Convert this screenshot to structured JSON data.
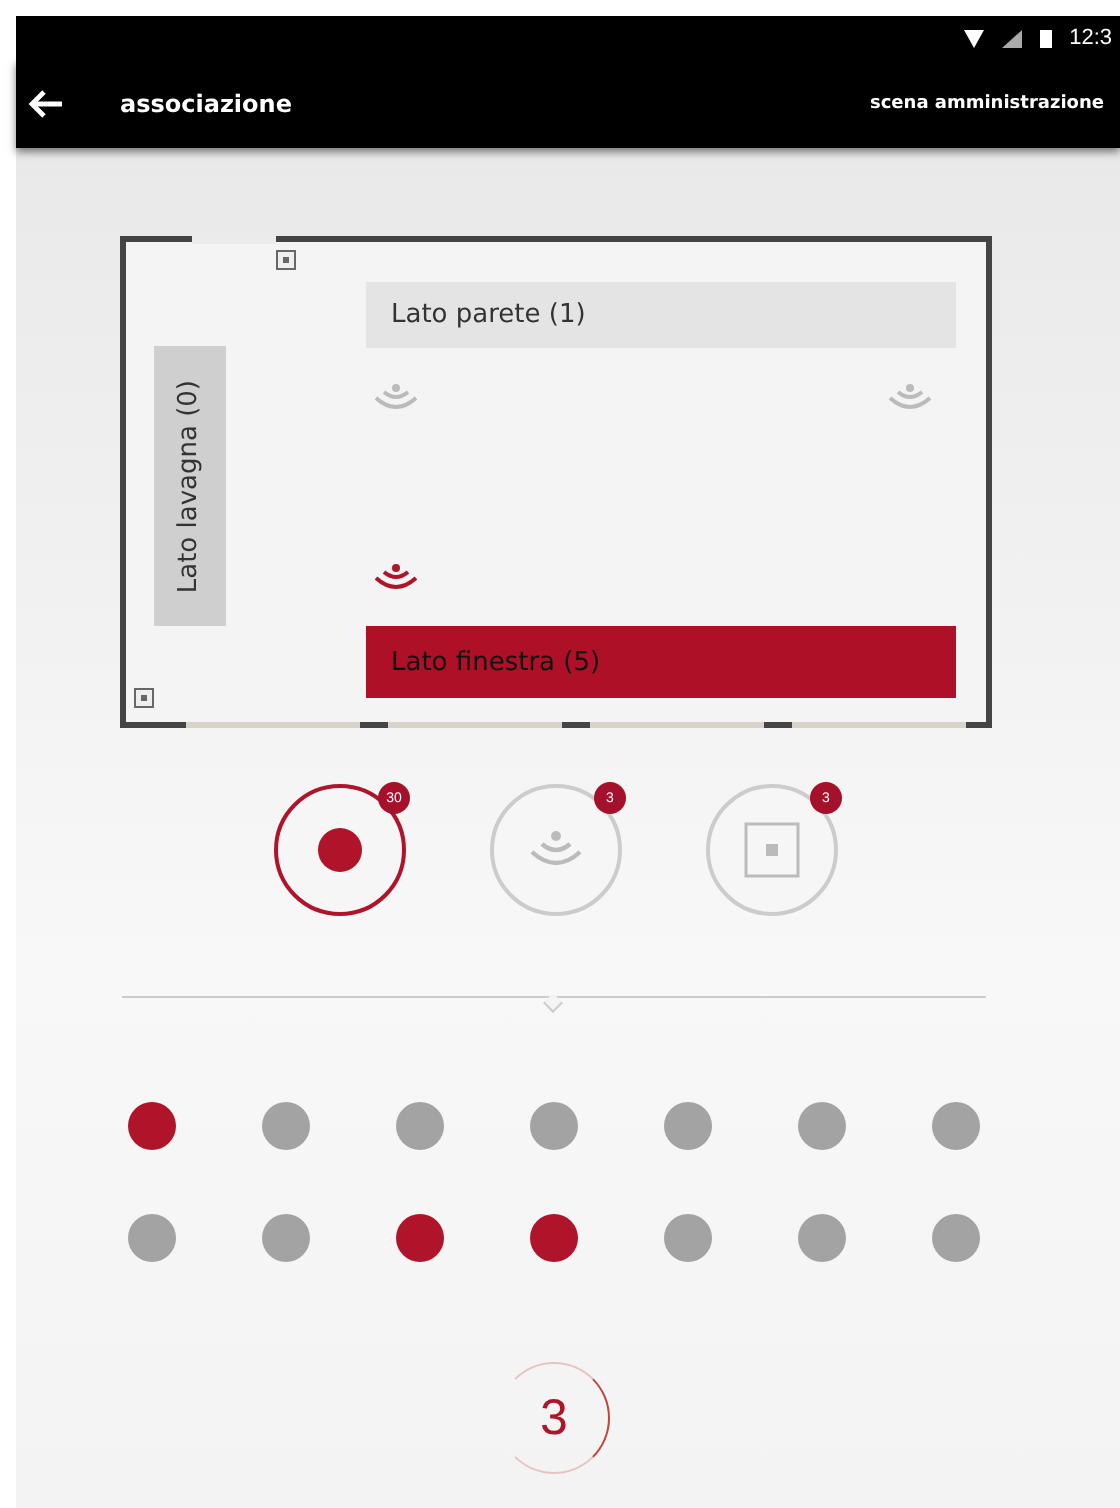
{
  "status_bar": {
    "time": "12:3"
  },
  "app_bar": {
    "title": "associazione",
    "action": "scena amministrazione"
  },
  "room": {
    "sides": [
      {
        "kind": "top",
        "label": "Lato parete (1)",
        "selected": false
      },
      {
        "kind": "left",
        "label": "Lato lavagna (0)",
        "selected": false
      },
      {
        "kind": "bottom",
        "label": "Lato finestra (5)",
        "selected": true
      }
    ],
    "sensors": [
      {
        "selected": false
      },
      {
        "selected": false
      },
      {
        "selected": true
      }
    ]
  },
  "modes": [
    {
      "kind": "point",
      "badge": "30",
      "selected": true
    },
    {
      "kind": "signal",
      "badge": "3",
      "selected": false
    },
    {
      "kind": "square",
      "badge": "3",
      "selected": false
    }
  ],
  "dots": [
    {
      "selected": true
    },
    {
      "selected": false
    },
    {
      "selected": false
    },
    {
      "selected": false
    },
    {
      "selected": false
    },
    {
      "selected": false
    },
    {
      "selected": false
    },
    {
      "selected": false
    },
    {
      "selected": false
    },
    {
      "selected": true
    },
    {
      "selected": true
    },
    {
      "selected": false
    },
    {
      "selected": false
    },
    {
      "selected": false
    }
  ],
  "step": "3"
}
